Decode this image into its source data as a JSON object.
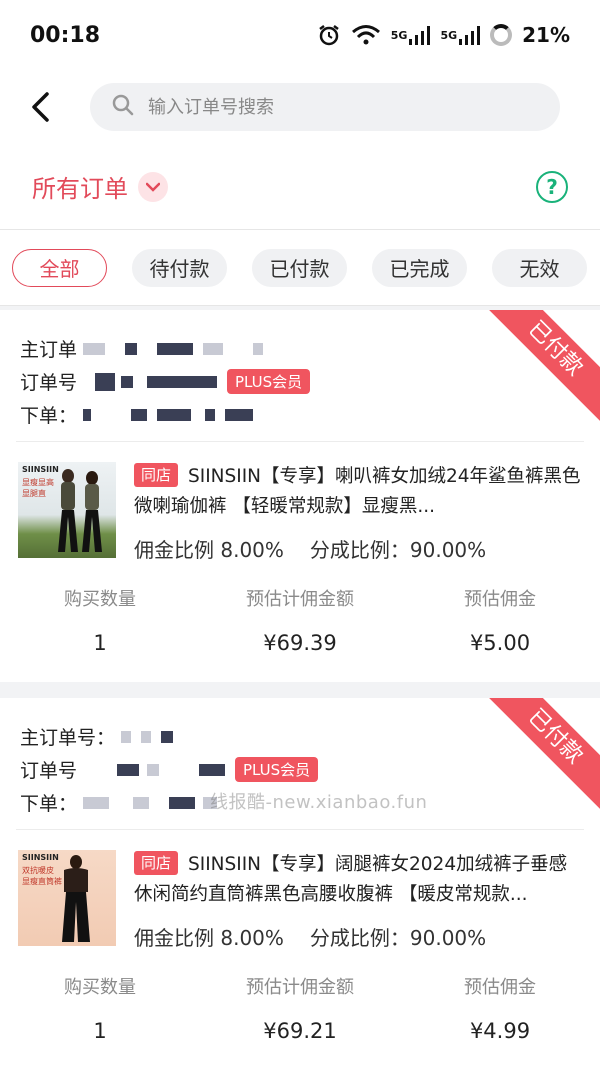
{
  "status_bar": {
    "time": "00:18",
    "network_1": "5G",
    "network_2": "5G",
    "battery": "21%"
  },
  "search": {
    "placeholder": "输入订单号搜索"
  },
  "filter": {
    "title": "所有订单",
    "help_icon": "?"
  },
  "tabs": [
    {
      "label": "全部",
      "active": true
    },
    {
      "label": "待付款",
      "active": false
    },
    {
      "label": "已付款",
      "active": false
    },
    {
      "label": "已完成",
      "active": false
    },
    {
      "label": "无效",
      "active": false
    }
  ],
  "orders": [
    {
      "status": "已付款",
      "main_order_label": "主订单",
      "order_label": "订单号",
      "placed_label": "下单：",
      "member_badge": "PLUS会员",
      "store_tag": "同店",
      "title": "SIINSIIN【专享】喇叭裤女加绒24年鲨鱼裤黑色微喇瑜伽裤 【轻暖常规款】显瘦黑...",
      "commission_rate": "佣金比例 8.00%",
      "share_rate": "分成比例：90.00%",
      "thumb_brand": "SIINSIIN",
      "thumb_tag_1": "显瘦显高",
      "thumb_tag_2": "显腿直",
      "stats": [
        {
          "label": "购买数量",
          "value": "1"
        },
        {
          "label": "预估计佣金额",
          "value": "¥69.39"
        },
        {
          "label": "预估佣金",
          "value": "¥5.00"
        }
      ]
    },
    {
      "status": "已付款",
      "main_order_label": "主订单号：",
      "order_label": "订单号",
      "placed_label": "下单：",
      "member_badge": "PLUS会员",
      "store_tag": "同店",
      "title": "SIINSIIN【专享】阔腿裤女2024加绒裤子垂感休闲简约直筒裤黑色高腰收腹裤 【暖皮常规款...",
      "commission_rate": "佣金比例 8.00%",
      "share_rate": "分成比例：90.00%",
      "thumb_brand": "SIINSIIN",
      "thumb_tag_1": "双抗暖皮",
      "thumb_tag_2": "显瘦直筒裤",
      "stats": [
        {
          "label": "购买数量",
          "value": "1"
        },
        {
          "label": "预估计佣金额",
          "value": "¥69.21"
        },
        {
          "label": "预估佣金",
          "value": "¥4.99"
        }
      ]
    }
  ],
  "watermark": "线报酷-new.xianbao.fun",
  "colors": {
    "accent": "#e24a5a",
    "badge": "#f0555f",
    "help": "#19b27a"
  }
}
